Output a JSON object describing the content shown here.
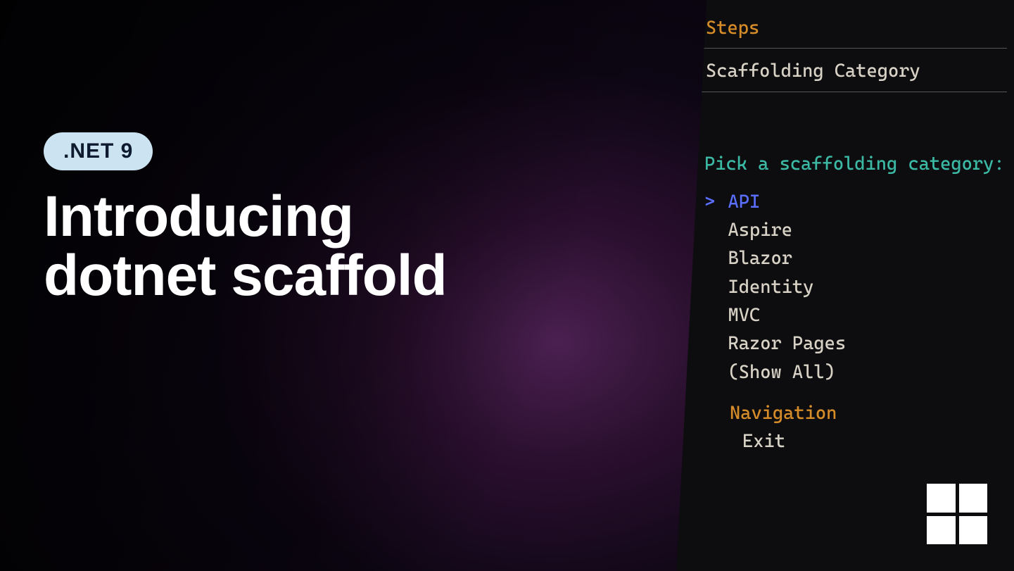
{
  "badge": {
    "label": ".NET 9"
  },
  "title": {
    "line1": "Introducing",
    "line2": "dotnet scaffold"
  },
  "terminal": {
    "steps_label": "Steps",
    "section_title": "Scaffolding Category",
    "prompt": "Pick a scaffolding category:",
    "selection_caret": ">",
    "options": [
      {
        "label": "API",
        "selected": true
      },
      {
        "label": "Aspire",
        "selected": false
      },
      {
        "label": "Blazor",
        "selected": false
      },
      {
        "label": "Identity",
        "selected": false
      },
      {
        "label": "MVC",
        "selected": false
      },
      {
        "label": "Razor Pages",
        "selected": false
      },
      {
        "label": "(Show All)",
        "selected": false
      }
    ],
    "navigation_label": "Navigation",
    "exit_label": "Exit"
  },
  "logo": {
    "name": "microsoft"
  }
}
